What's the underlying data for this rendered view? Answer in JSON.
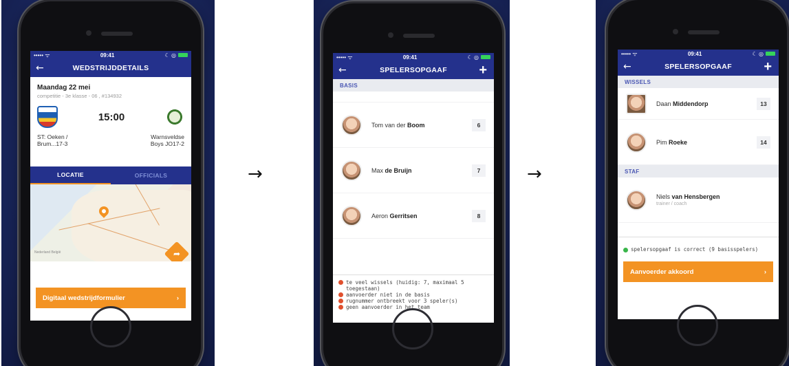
{
  "arrows": [
    "→",
    "→"
  ],
  "statusbar": {
    "signal": "••••• ᯤ",
    "time": "09:41",
    "icons": "☾ ◎"
  },
  "screen1": {
    "title": "WEDSTRIJDDETAILS",
    "back": "←",
    "date": "Maandag 22 mei",
    "sub": "competitie - 3e klasse - 06 , #134932",
    "time": "15:00",
    "home_team_line1": "ST: Oeken /",
    "home_team_line2": "Brum...17-3",
    "away_team_line1": "Warnsveldse",
    "away_team_line2": "Boys JO17-2",
    "tab_locatie": "LOCATIE",
    "tab_officials": "OFFICIALS",
    "map_label": "Nederland België",
    "nav_icon": "turn-right-icon",
    "cta": "Digitaal wedstrijdformulier",
    "cta_chevron": "›"
  },
  "screen2": {
    "title": "SPELERSOPGAAF",
    "back": "←",
    "plus": "+",
    "section": "BASIS",
    "players": [
      {
        "first": "Tom van der ",
        "last": "Boom",
        "number": "6"
      },
      {
        "first": "Max ",
        "last": "de Bruijn",
        "number": "7"
      },
      {
        "first": "Aeron ",
        "last": "Gerritsen",
        "number": "8"
      }
    ],
    "errors": [
      "te veel wissels (huidig: 7, maximaal 5 toegestaan)",
      "aanvoerder niet in de basis",
      "rugnummer ontbreekt voor 3 speler(s)",
      "geen aanvoerder in het team"
    ]
  },
  "screen3": {
    "title": "SPELERSOPGAAF",
    "back": "←",
    "plus": "+",
    "section_wissels": "WISSELS",
    "section_staf": "STAF",
    "subs": [
      {
        "first": "Daan ",
        "last": "Middendorp",
        "number": "13"
      },
      {
        "first": "Pim ",
        "last": "Roeke",
        "number": "14"
      }
    ],
    "staff": {
      "first": "Niels ",
      "last": "van Hensbergen",
      "role": "trainer / coach"
    },
    "status": "spelersopgaaf is correct (9 basisspelers)",
    "cta": "Aanvoerder akkoord",
    "cta_chevron": "›"
  },
  "colors": {
    "brand": "#24318c",
    "accent": "#f39323",
    "error": "#e0502e",
    "success": "#39b54a"
  }
}
